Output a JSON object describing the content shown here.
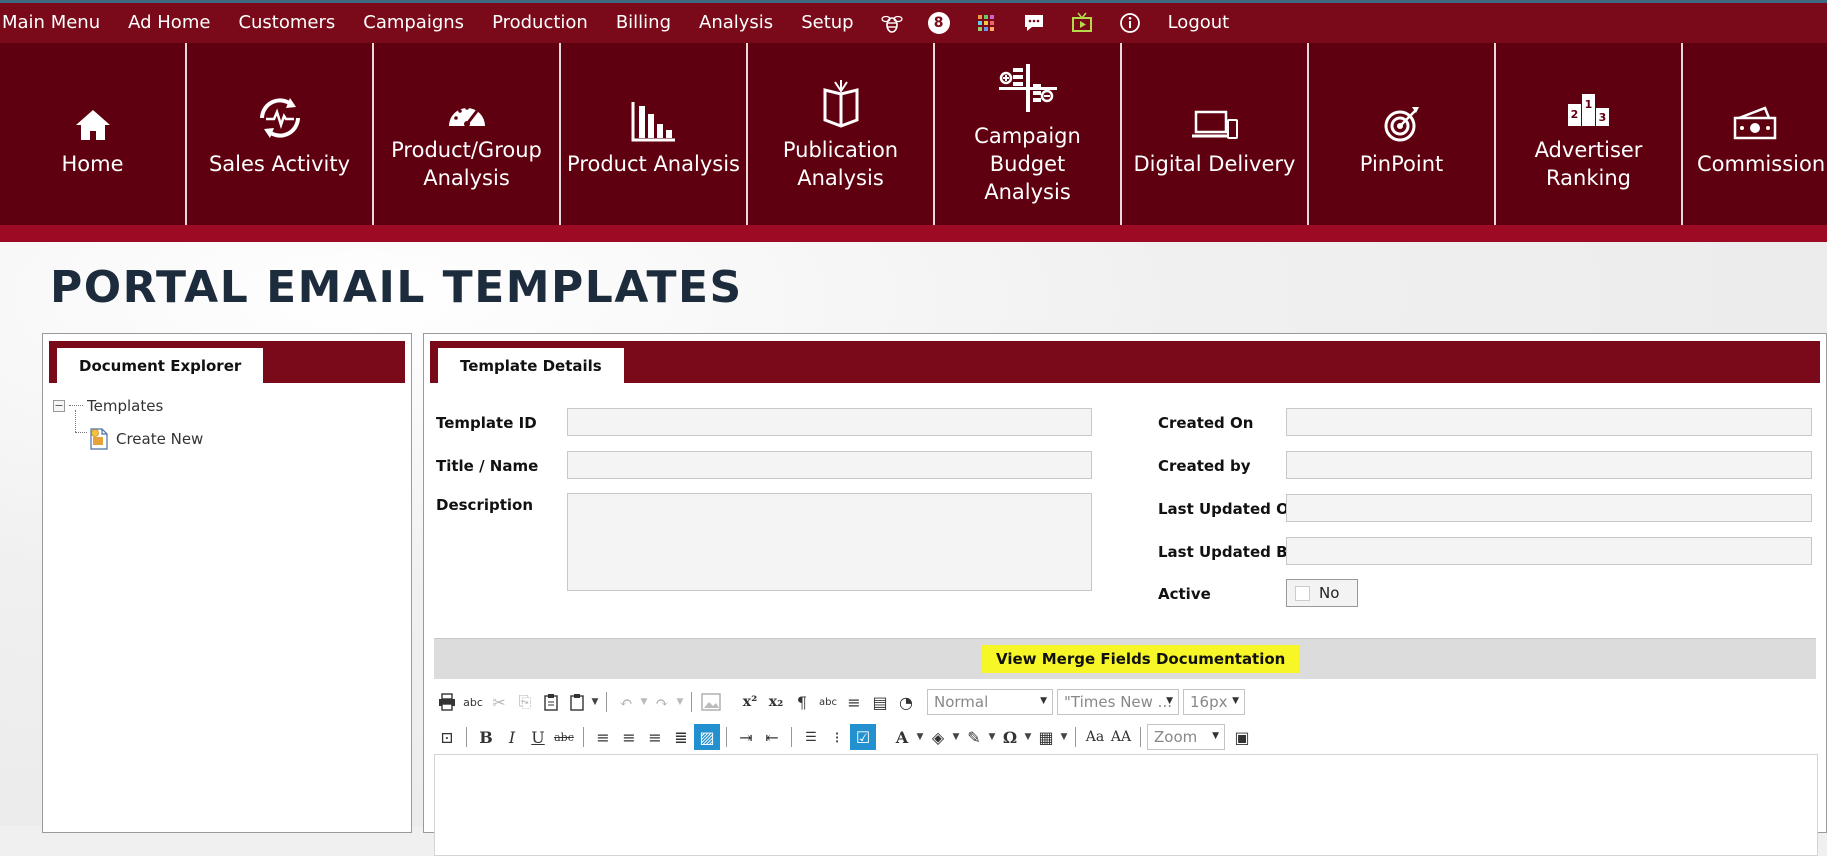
{
  "topmenu": {
    "items": [
      "Main Menu",
      "Ad Home",
      "Customers",
      "Campaigns",
      "Production",
      "Billing",
      "Analysis",
      "Setup"
    ],
    "badge_count": "8",
    "logout": "Logout"
  },
  "tiles": [
    {
      "label": "Home",
      "icon": "home-icon"
    },
    {
      "label": "Sales Activity",
      "icon": "refresh-pulse-icon"
    },
    {
      "label": "Product/Group\nAnalysis",
      "icon": "gauge-icon"
    },
    {
      "label": "Product Analysis",
      "icon": "bar-chart-icon"
    },
    {
      "label": "Publication\nAnalysis",
      "icon": "open-book-icon"
    },
    {
      "label": "Campaign Budget\nAnalysis",
      "icon": "budget-icon"
    },
    {
      "label": "Digital Delivery",
      "icon": "devices-icon"
    },
    {
      "label": "PinPoint",
      "icon": "target-icon"
    },
    {
      "label": "Advertiser\nRanking",
      "icon": "podium-icon"
    },
    {
      "label": "Commission",
      "icon": "money-icon"
    }
  ],
  "page": {
    "title": "PORTAL EMAIL TEMPLATES"
  },
  "explorer": {
    "tab": "Document Explorer",
    "root": "Templates",
    "expander": "−",
    "child": "Create New"
  },
  "details": {
    "tab": "Template Details",
    "labels": {
      "template_id": "Template ID",
      "title": "Title / Name",
      "description": "Description",
      "created_on": "Created On",
      "created_by": "Created by",
      "last_updated_on": "Last Updated On",
      "last_updated_by": "Last Updated By",
      "active": "Active"
    },
    "values": {
      "template_id": "",
      "title": "",
      "description": "",
      "created_on": "",
      "created_by": "",
      "last_updated_on": "",
      "last_updated_by": ""
    },
    "active_value": "No",
    "merge_button": "View Merge Fields Documentation"
  },
  "editor": {
    "format_block": "Normal",
    "font_name": "\"Times New ...",
    "font_size": "16px",
    "zoom": "Zoom",
    "superscript": "x²",
    "subscript": "x₂",
    "bold": "B",
    "italic": "I",
    "underline": "U",
    "strike": "abc",
    "font_color": "A",
    "omega": "Ω",
    "case_lower": "Aa",
    "case_upper": "AA",
    "paragraph": "¶",
    "spell": "abc"
  },
  "colors": {
    "menu_bg": "#7a0a1a",
    "tile_bg": "#5e0010",
    "accent_strip": "#9d0a24",
    "title": "#1d2c3c",
    "highlight": "#f7f728",
    "active_tool": "#2390cf"
  }
}
